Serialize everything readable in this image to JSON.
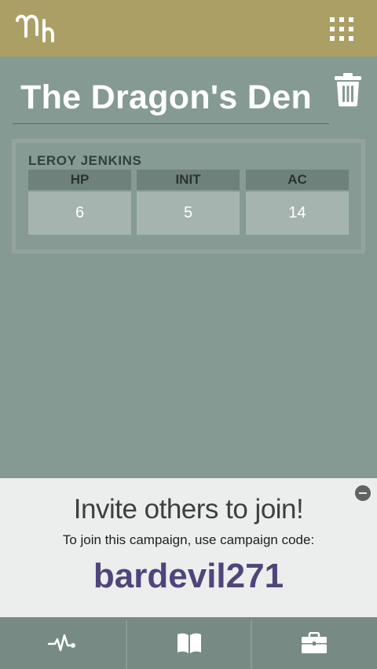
{
  "header": {
    "logo_icon": "mh-logo-icon",
    "menu_icon": "grid-menu-icon",
    "bar_color": "#ab9f66"
  },
  "campaign": {
    "title": "The Dragon's Den",
    "delete_icon": "trash-icon"
  },
  "character": {
    "name": "LEROY JENKINS",
    "stats": [
      {
        "label": "HP",
        "value": "6"
      },
      {
        "label": "INIT",
        "value": "5"
      },
      {
        "label": "AC",
        "value": "14"
      }
    ]
  },
  "invite": {
    "heading": "Invite others to join!",
    "subtext": "To join this campaign, use campaign code:",
    "code": "bardevil271",
    "code_color": "#4f457b",
    "close_icon": "minus-circle-icon"
  },
  "bottom_nav": [
    {
      "icon": "activity-pulse-icon"
    },
    {
      "icon": "book-icon"
    },
    {
      "icon": "briefcase-icon"
    }
  ]
}
